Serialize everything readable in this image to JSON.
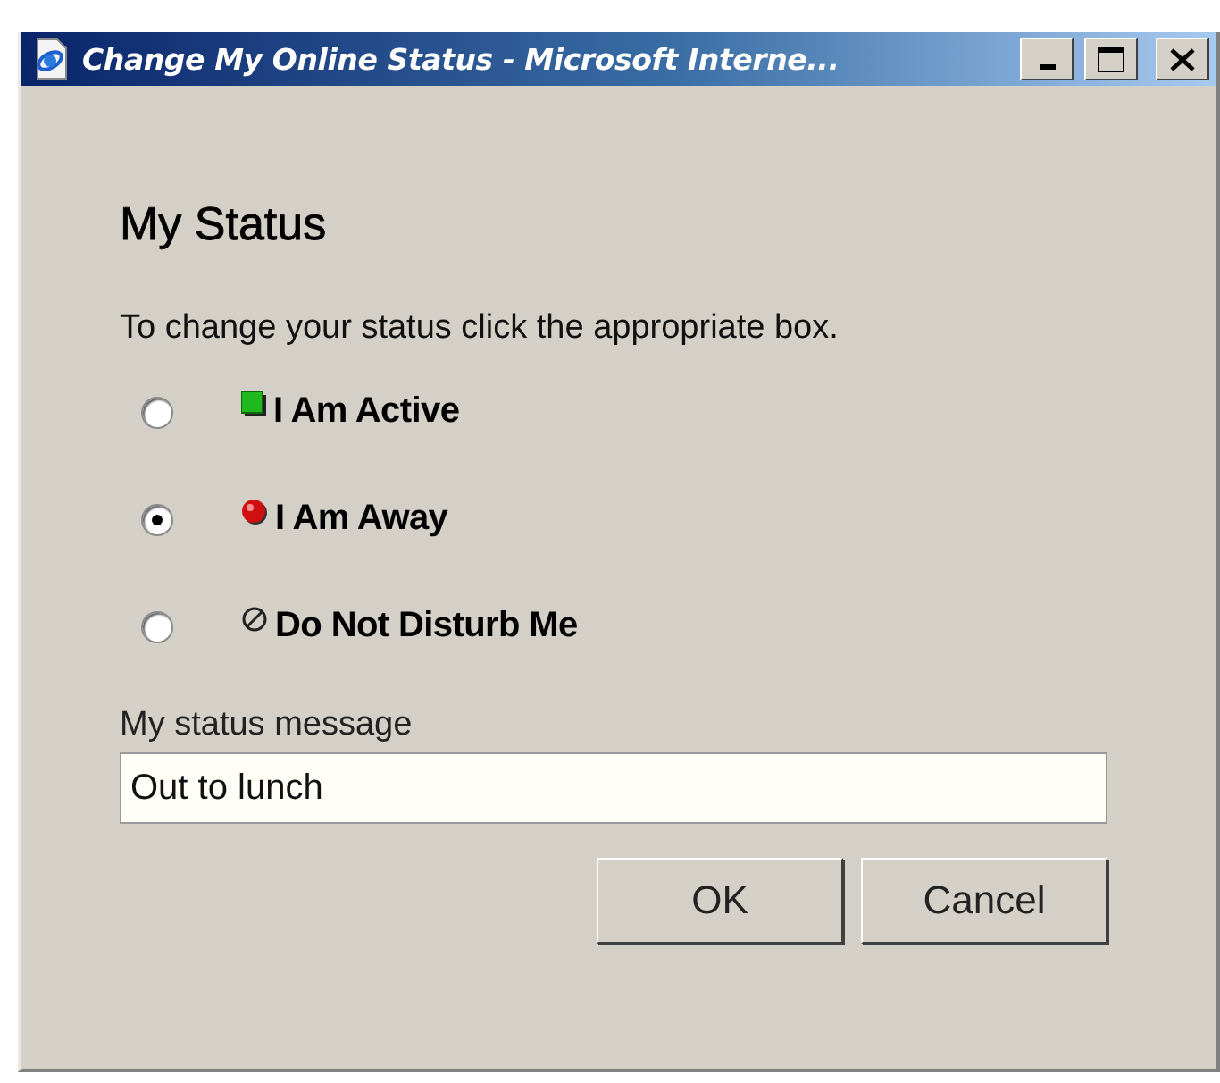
{
  "window": {
    "title": "Change My Online Status - Microsoft Interne..."
  },
  "heading": "My Status",
  "instruction": "To change your status click the appropriate box.",
  "options": [
    {
      "kind": "active",
      "label": "I Am Active",
      "selected": false
    },
    {
      "kind": "away",
      "label": "I Am Away",
      "selected": true
    },
    {
      "kind": "dnd",
      "label": "Do Not Disturb Me",
      "selected": false
    }
  ],
  "message": {
    "label": "My status message",
    "value": "Out to lunch"
  },
  "buttons": [
    "OK",
    "Cancel"
  ]
}
